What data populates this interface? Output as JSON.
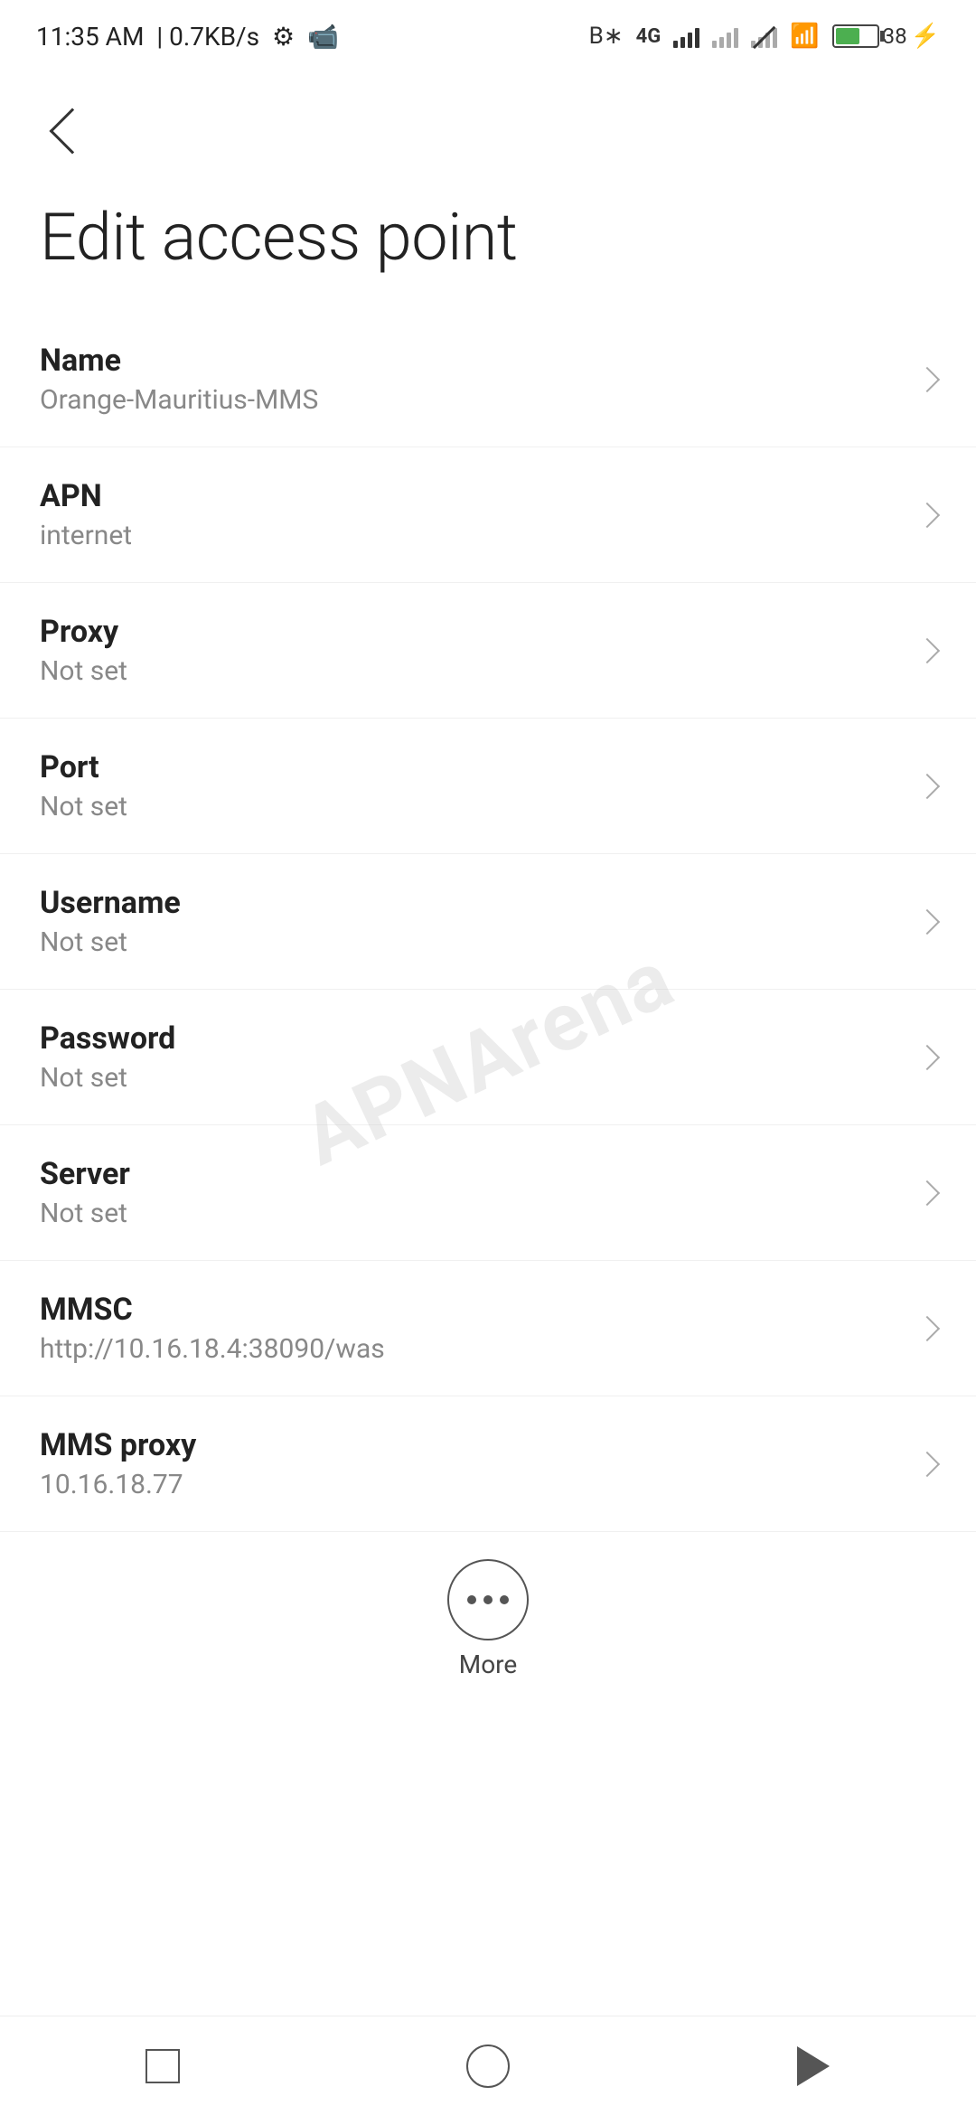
{
  "statusBar": {
    "time": "11:35 AM",
    "speed": "0.7KB/s",
    "battery": "38"
  },
  "nav": {
    "backLabel": "back"
  },
  "page": {
    "title": "Edit access point"
  },
  "settings": [
    {
      "label": "Name",
      "value": "Orange-Mauritius-MMS"
    },
    {
      "label": "APN",
      "value": "internet"
    },
    {
      "label": "Proxy",
      "value": "Not set"
    },
    {
      "label": "Port",
      "value": "Not set"
    },
    {
      "label": "Username",
      "value": "Not set"
    },
    {
      "label": "Password",
      "value": "Not set"
    },
    {
      "label": "Server",
      "value": "Not set"
    },
    {
      "label": "MMSC",
      "value": "http://10.16.18.4:38090/was"
    },
    {
      "label": "MMS proxy",
      "value": "10.16.18.77"
    }
  ],
  "more": {
    "label": "More"
  },
  "watermark": "APNArena"
}
